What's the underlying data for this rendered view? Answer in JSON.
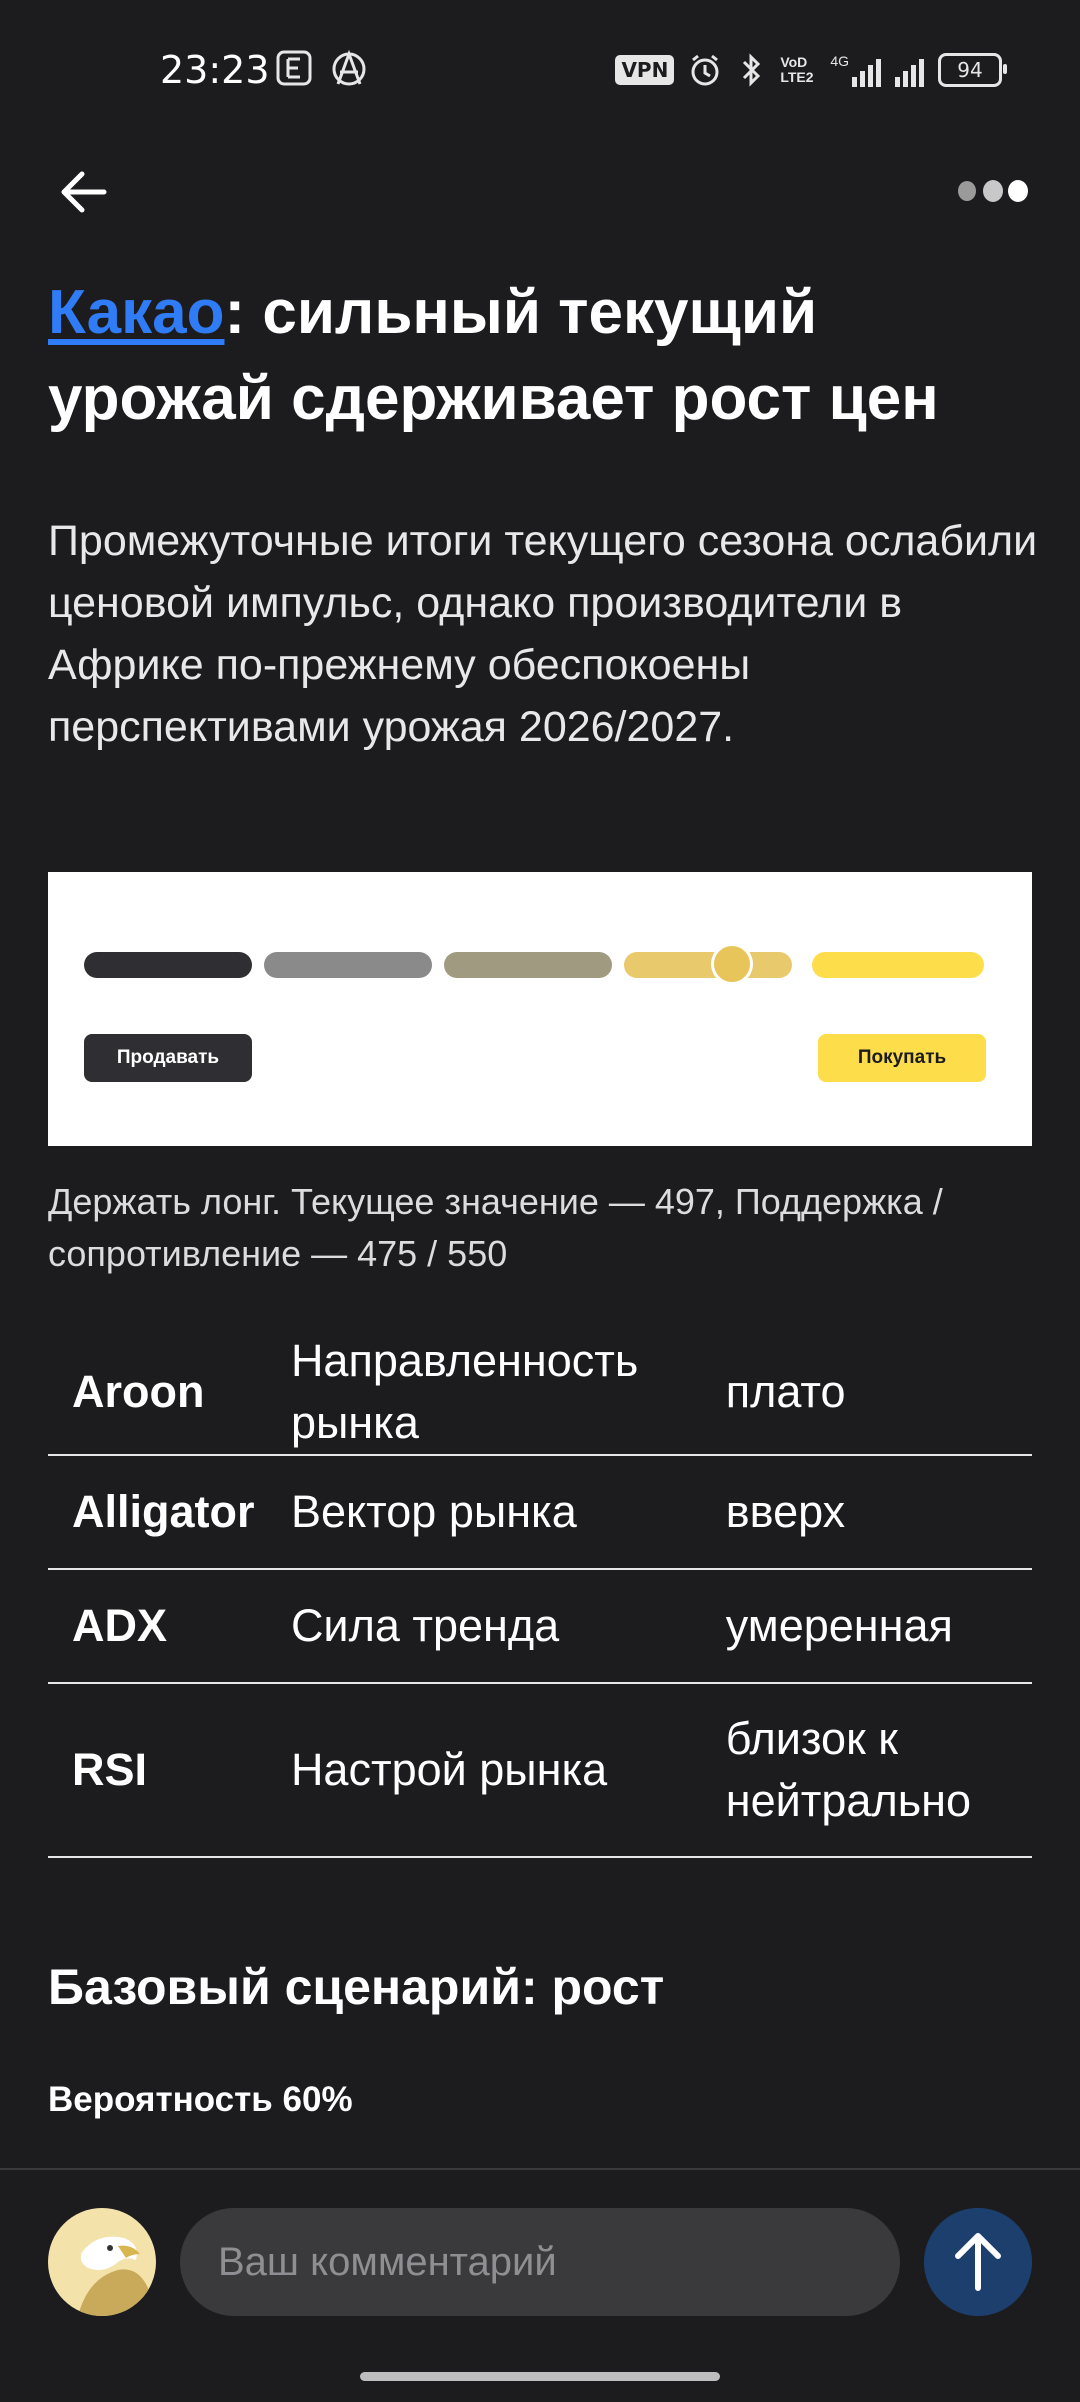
{
  "status_bar": {
    "time": "23:23",
    "vpn": "VPN",
    "network": "4G",
    "volte": "VoD LTE2",
    "battery": "94"
  },
  "top_bar": {
    "back_icon": "arrow-left-icon",
    "more_icon": "more-dots-icon"
  },
  "article": {
    "title_link": "Какао",
    "title_rest": ": сильный текущий урожай сдерживает рост цен",
    "lead": "Промежуточные итоги текущего сезона ослабили ценовой импульс, однако производители в Африке по-прежнему обеспокоены перспективами урожая 2026/2027.",
    "signal": {
      "sell_label": "Продавать",
      "buy_label": "Покупать",
      "position_fraction": 0.72
    },
    "caption": "Держать лонг. Текущее значение — 497, Поддержка / сопротивление — 475 / 550",
    "indicators": [
      {
        "name": "Aroon",
        "metric": "Направленность рынка",
        "value": "плато"
      },
      {
        "name": "Alligator",
        "metric": "Вектор рынка",
        "value": "вверх"
      },
      {
        "name": "ADX",
        "metric": "Сила тренда",
        "value": "умеренная"
      },
      {
        "name": "RSI",
        "metric": "Настрой рынка",
        "value": "близок к нейтрально"
      }
    ],
    "scenario_heading": "Базовый сценарий: рост",
    "probability": "Вероятность 60%"
  },
  "comment_bar": {
    "placeholder": "Ваш комментарий",
    "avatar_icon": "eagle-avatar-icon",
    "send_icon": "arrow-up-icon"
  },
  "colors": {
    "background": "#1c1c1e",
    "link": "#2f7cf6",
    "buy": "#fddd4a",
    "send_button": "#1d3f6e"
  }
}
